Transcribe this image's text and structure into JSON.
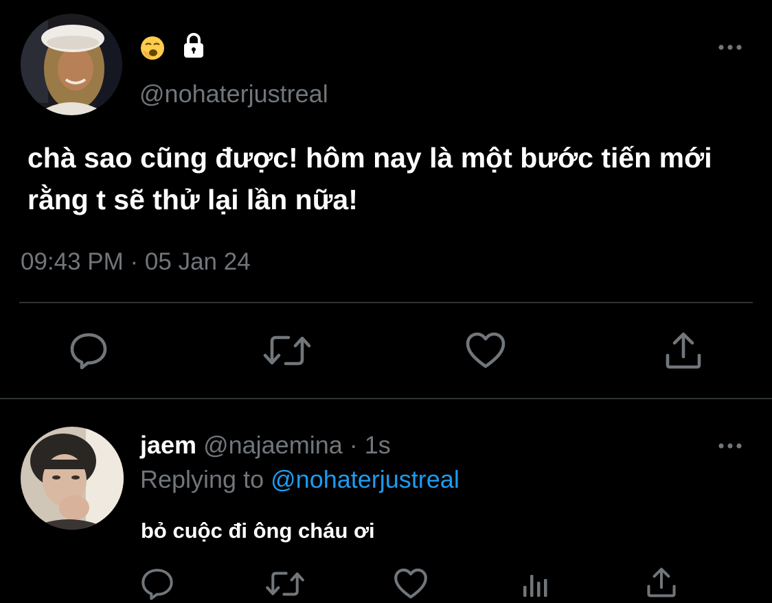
{
  "main_tweet": {
    "avatar": "user-avatar-woman-beret",
    "name_emoji": "🥱",
    "lock_icon": "lock-icon",
    "handle": "@nohaterjustreal",
    "text": "chà sao cũng được! hôm nay là một bước tiến mới rằng t sẽ thử lại lần nữa!",
    "timestamp": "09:43 PM · 05 Jan 24",
    "more_icon": "more-horizontal-icon",
    "actions": [
      "reply-icon",
      "retweet-icon",
      "like-icon",
      "share-icon"
    ]
  },
  "reply": {
    "avatar": "user-avatar-man",
    "name": "jaem",
    "handle": "@najaemina",
    "separator": "·",
    "time": "1s",
    "replying_label": "Replying to",
    "replying_target": "@nohaterjustreal",
    "text": "bỏ cuộc đi ông cháu ơi",
    "more_icon": "more-horizontal-icon",
    "actions": [
      "reply-icon",
      "retweet-icon",
      "like-icon",
      "analytics-icon",
      "share-icon"
    ]
  },
  "colors": {
    "background": "#000000",
    "text_primary": "#ffffff",
    "text_secondary": "#71767b",
    "link": "#1d9bf0",
    "divider": "#2f3336"
  }
}
